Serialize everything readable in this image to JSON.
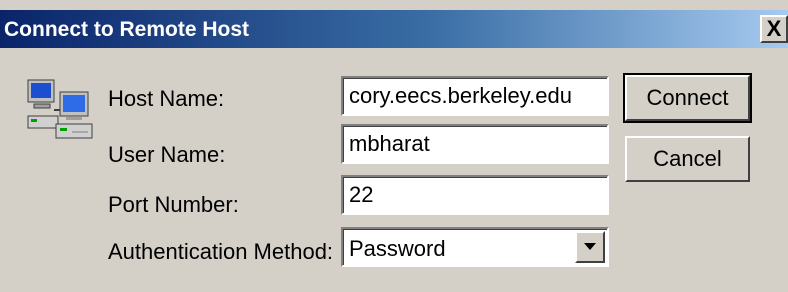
{
  "window": {
    "title": "Connect to Remote Host",
    "close_label": "X"
  },
  "icon": "network-computers-icon",
  "form": {
    "host_name": {
      "label": "Host Name:",
      "value": "cory.eecs.berkeley.edu"
    },
    "user_name": {
      "label": "User Name:",
      "value": "mbharat"
    },
    "port_number": {
      "label": "Port Number:",
      "value": "22"
    },
    "auth_method": {
      "label": "Authentication Method:",
      "value": "Password"
    }
  },
  "buttons": {
    "connect": "Connect",
    "cancel": "Cancel"
  },
  "colors": {
    "title_start": "#0a246a",
    "title_end": "#a6caf0",
    "face": "#d4d0c8"
  }
}
